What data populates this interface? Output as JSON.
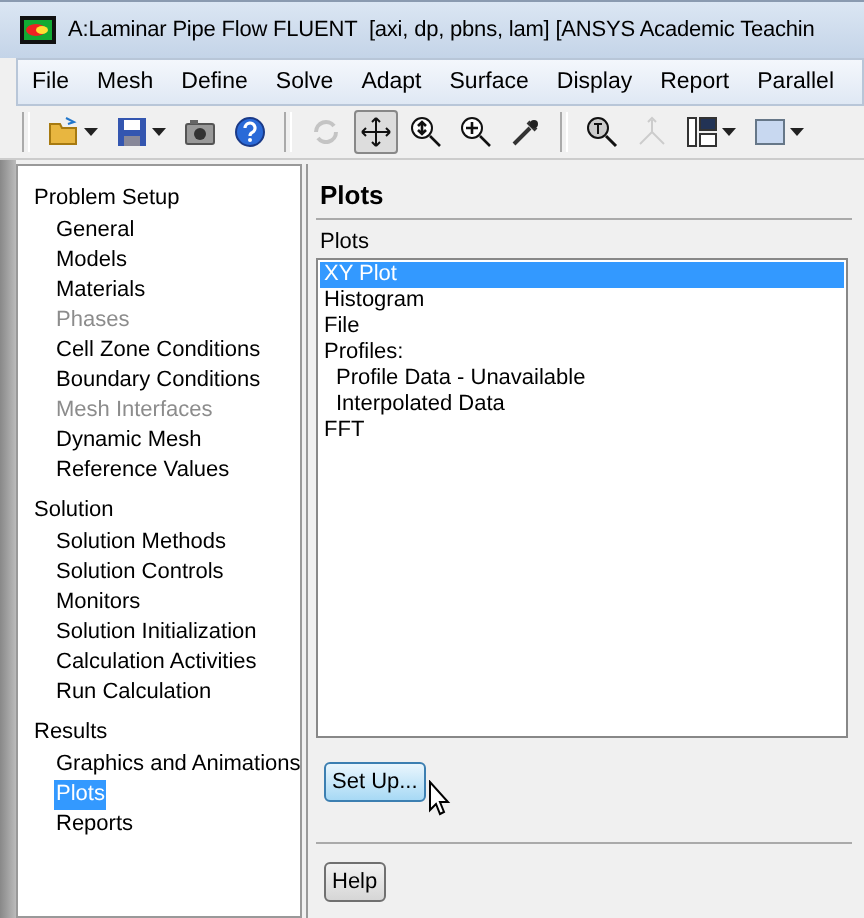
{
  "window": {
    "title": "A:Laminar Pipe Flow FLUENT  [axi, dp, pbns, lam] [ANSYS Academic Teachin"
  },
  "menu": [
    "File",
    "Mesh",
    "Define",
    "Solve",
    "Adapt",
    "Surface",
    "Display",
    "Report",
    "Parallel"
  ],
  "toolbar": [
    {
      "disabled": false,
      "pressed": false,
      "dropdown": true
    },
    {
      "disabled": false,
      "pressed": false,
      "dropdown": true
    },
    {
      "disabled": false,
      "pressed": false,
      "dropdown": false
    },
    {
      "disabled": false,
      "pressed": false,
      "dropdown": false
    },
    {
      "disabled": true,
      "pressed": false,
      "dropdown": false
    },
    {
      "disabled": false,
      "pressed": true,
      "dropdown": false
    },
    {
      "disabled": false,
      "pressed": false,
      "dropdown": false
    },
    {
      "disabled": false,
      "pressed": false,
      "dropdown": false
    },
    {
      "disabled": false,
      "pressed": false,
      "dropdown": false
    },
    {
      "disabled": false,
      "pressed": false,
      "dropdown": false
    },
    {
      "disabled": true,
      "pressed": false,
      "dropdown": false
    },
    {
      "disabled": false,
      "pressed": false,
      "dropdown": true
    },
    {
      "disabled": false,
      "pressed": false,
      "dropdown": true
    }
  ],
  "sidebar": [
    {
      "title": "Problem Setup",
      "items": [
        {
          "label": "General",
          "disabled": false,
          "selected": false
        },
        {
          "label": "Models",
          "disabled": false,
          "selected": false
        },
        {
          "label": "Materials",
          "disabled": false,
          "selected": false
        },
        {
          "label": "Phases",
          "disabled": true,
          "selected": false
        },
        {
          "label": "Cell Zone Conditions",
          "disabled": false,
          "selected": false
        },
        {
          "label": "Boundary Conditions",
          "disabled": false,
          "selected": false
        },
        {
          "label": "Mesh Interfaces",
          "disabled": true,
          "selected": false
        },
        {
          "label": "Dynamic Mesh",
          "disabled": false,
          "selected": false
        },
        {
          "label": "Reference Values",
          "disabled": false,
          "selected": false
        }
      ]
    },
    {
      "title": "Solution",
      "items": [
        {
          "label": "Solution Methods",
          "disabled": false,
          "selected": false
        },
        {
          "label": "Solution Controls",
          "disabled": false,
          "selected": false
        },
        {
          "label": "Monitors",
          "disabled": false,
          "selected": false
        },
        {
          "label": "Solution Initialization",
          "disabled": false,
          "selected": false
        },
        {
          "label": "Calculation Activities",
          "disabled": false,
          "selected": false
        },
        {
          "label": "Run Calculation",
          "disabled": false,
          "selected": false
        }
      ]
    },
    {
      "title": "Results",
      "items": [
        {
          "label": "Graphics and Animations",
          "disabled": false,
          "selected": false
        },
        {
          "label": "Plots",
          "disabled": false,
          "selected": true
        },
        {
          "label": "Reports",
          "disabled": false,
          "selected": false
        }
      ]
    }
  ],
  "panel": {
    "title": "Plots",
    "list_label": "Plots",
    "list": [
      {
        "label": "XY Plot",
        "selected": true
      },
      {
        "label": "Histogram",
        "selected": false
      },
      {
        "label": "File",
        "selected": false
      },
      {
        "label": "Profiles:",
        "selected": false,
        "children": [
          {
            "label": "Profile Data - Unavailable",
            "selected": false
          },
          {
            "label": "Interpolated Data",
            "selected": false
          }
        ]
      },
      {
        "label": "FFT",
        "selected": false
      }
    ],
    "setup_button": {
      "label": "Set Up...",
      "hover": true
    },
    "help_button": "Help"
  }
}
